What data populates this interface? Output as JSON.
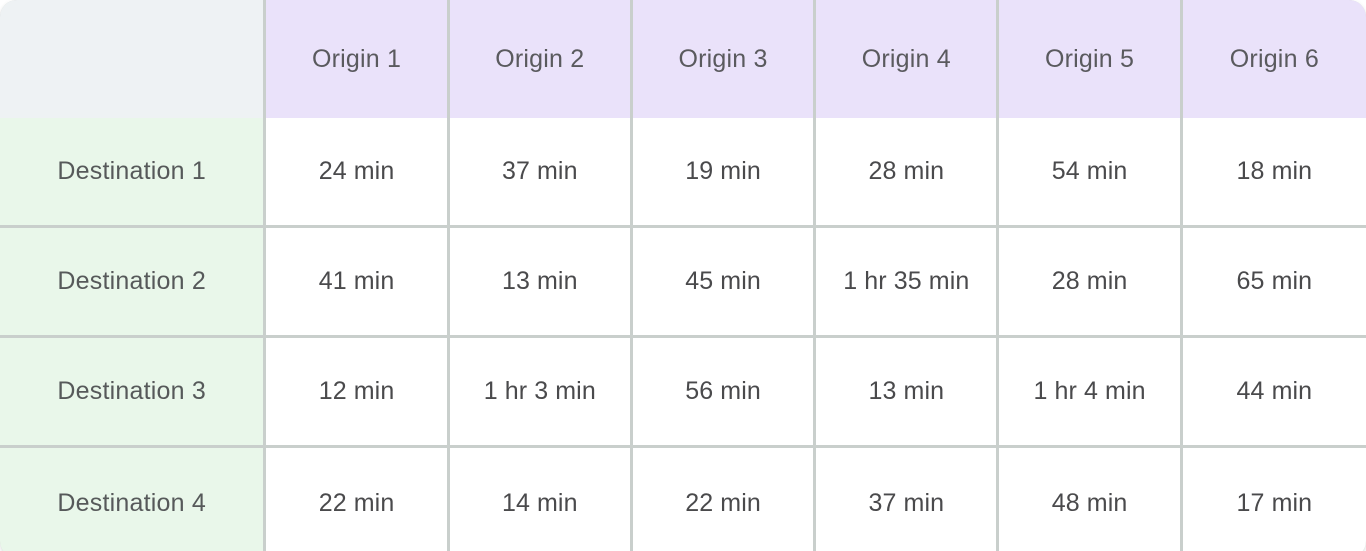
{
  "matrix": {
    "corner_label": "",
    "column_headers": [
      "Origin 1",
      "Origin 2",
      "Origin 3",
      "Origin 4",
      "Origin 5",
      "Origin 6"
    ],
    "row_headers": [
      "Destination 1",
      "Destination 2",
      "Destination 3",
      "Destination 4"
    ],
    "rows": [
      {
        "label": "Destination 1",
        "cells": [
          "24 min",
          "37 min",
          "19 min",
          "28 min",
          "54 min",
          "18 min"
        ]
      },
      {
        "label": "Destination 2",
        "cells": [
          "41 min",
          "13 min",
          "45 min",
          "1 hr 35 min",
          "28 min",
          "65 min"
        ]
      },
      {
        "label": "Destination 3",
        "cells": [
          "12 min",
          "1 hr 3 min",
          "56 min",
          "13 min",
          "1 hr 4 min",
          "44 min"
        ]
      },
      {
        "label": "Destination 4",
        "cells": [
          "22 min",
          "14 min",
          "22 min",
          "37 min",
          "48 min",
          "17 min"
        ]
      }
    ],
    "colors": {
      "column_header_bg": "#eae2fa",
      "row_header_bg": "#e9f7ea",
      "corner_bg": "#eef2f4",
      "data_bg": "#ffffff",
      "grid_line": "#c9cfcc",
      "header_text": "#5a5a5e",
      "data_text": "#4a4a4c"
    }
  }
}
